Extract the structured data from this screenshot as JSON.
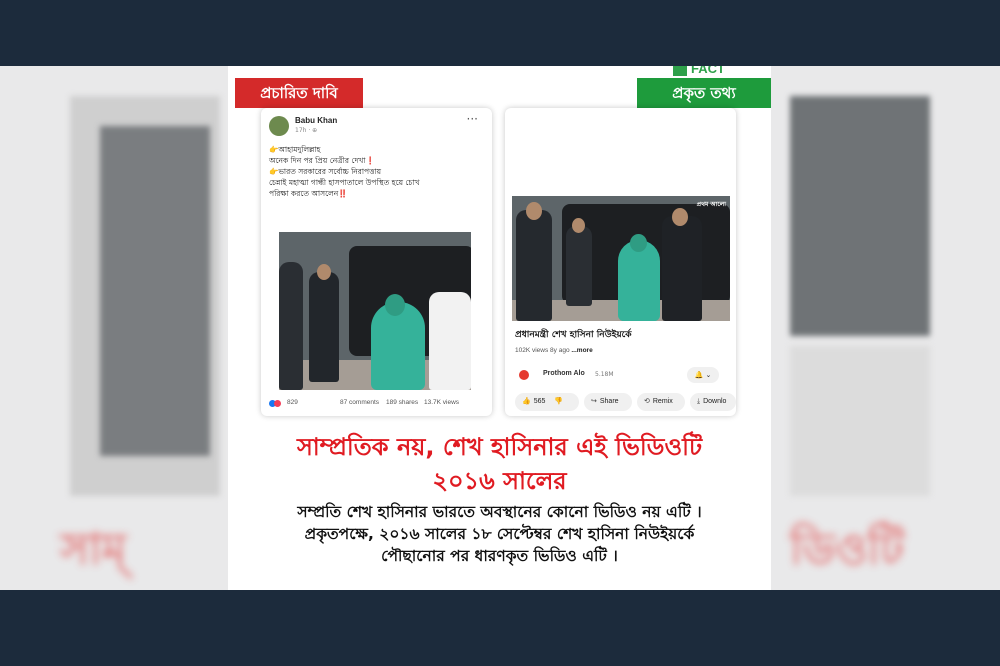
{
  "logo": {
    "text": "FACT"
  },
  "tags": {
    "claim": "প্রচারিত দাবি",
    "fact": "প্রকৃত তথ্য"
  },
  "facebook_post": {
    "author": "Babu Khan",
    "time": "17h · ⊕",
    "lines": [
      {
        "icon": "👉",
        "text": "আহামদুলিল্লাহ",
        "mark": ""
      },
      {
        "icon": "",
        "text": "অনেক দিন পর প্রিয় নেত্রীর দেখা",
        "mark": "❗"
      },
      {
        "icon": "👉",
        "text": "ভারত সরকারের সর্বোচ্চ নিরাপত্তায়",
        "mark": ""
      },
      {
        "icon": "",
        "text": "চেন্নাই মহাত্মা গান্ধী হাসপাতালে উপস্থিত হয়ে চোখ",
        "mark": ""
      },
      {
        "icon": "",
        "text": "পরিক্ষা করতে আসলেন",
        "mark": "‼️"
      }
    ],
    "reactions": "829",
    "comments": "87 comments",
    "shares": "189 shares",
    "views": "13.7K views"
  },
  "youtube_post": {
    "watermark": "প্রথম আলো",
    "title": "প্রধানমন্ত্রী শেখ হাসিনা নিউইয়র্কে",
    "meta": "102K views 8y ago",
    "more": "...more",
    "channel": "Prothom Alo",
    "subscribers": "5.18M",
    "bell": "🔔 ⌄",
    "actions": {
      "likes": "565",
      "share": "Share",
      "remix": "Remix",
      "download": "Downlo"
    }
  },
  "headline_lines": [
    "সাম্প্রতিক নয়, শেখ হাসিনার এই ভিডিওটি",
    "২০১৬ সালের"
  ],
  "body_lines": [
    "সম্প্রতি শেখ হাসিনার ভারতে অবস্থানের কোনো ভিডিও নয় এটি ।",
    "প্রকৃতপক্ষে, ২০১৬ সালের ১৮ সেপ্টেম্বর শেখ হাসিনা নিউইয়র্কে",
    "পৌছানোর পর ধারণকৃত ভিডিও এটি ।"
  ],
  "colors": {
    "frame": "#1c2b3c",
    "claim_tag": "#d42a2a",
    "fact_tag": "#1e9b3c",
    "headline": "#e01b22",
    "saree": "#35b29a"
  }
}
